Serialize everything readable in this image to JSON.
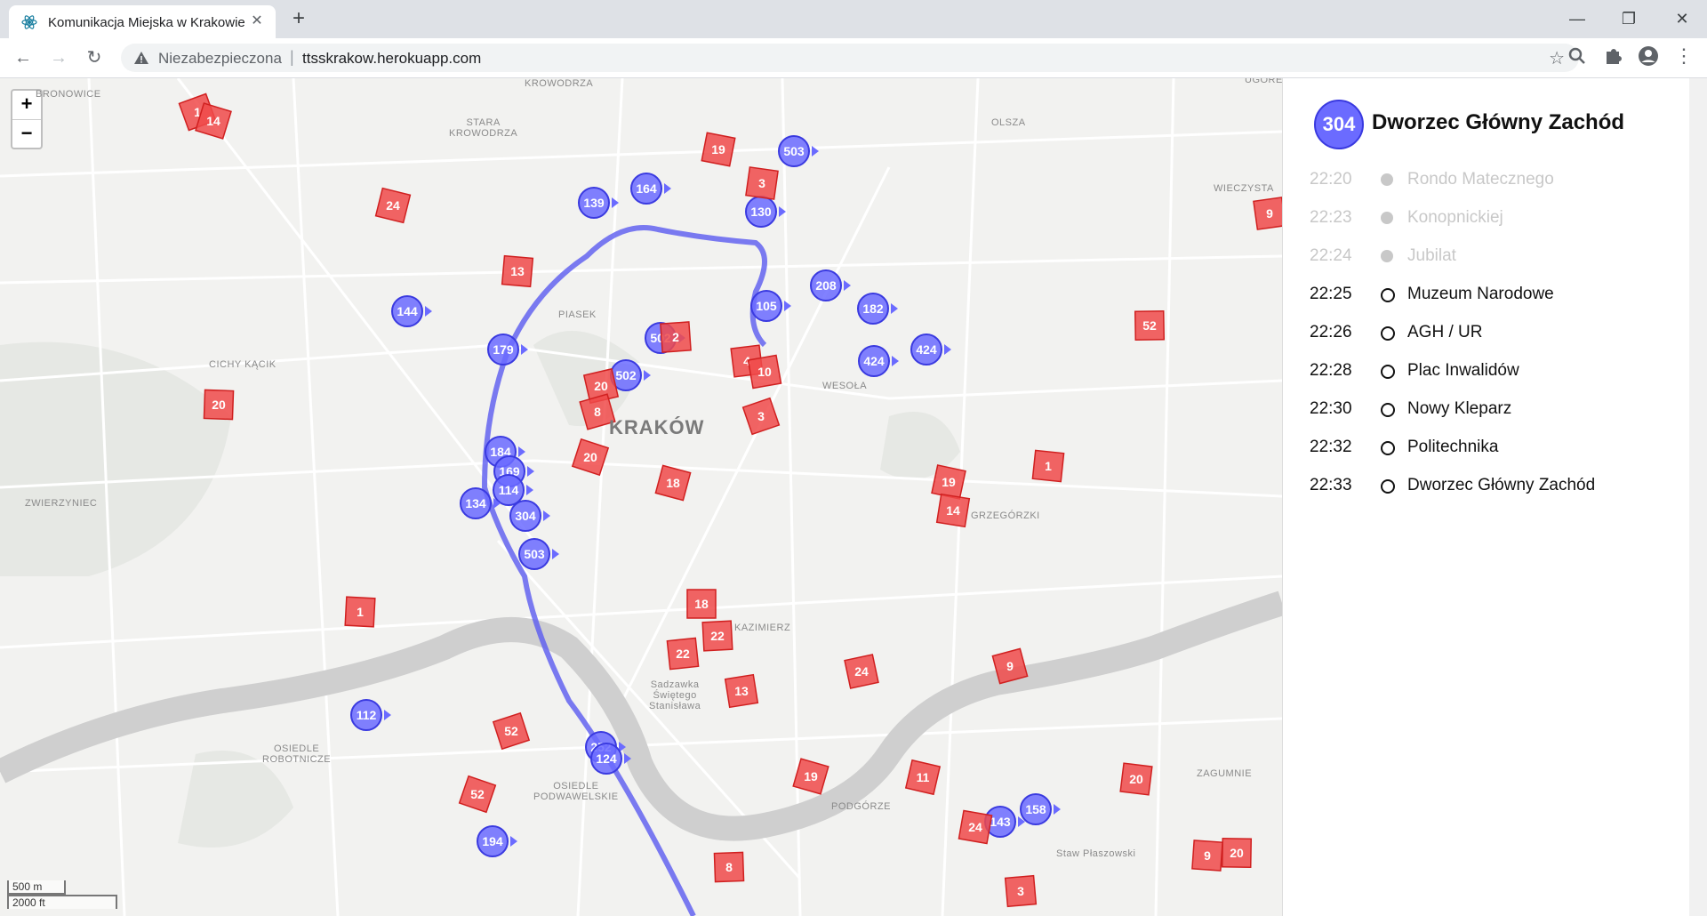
{
  "browser": {
    "tab_title": "Komunikacja Miejska w Krakowie",
    "tab_close": "✕",
    "new_tab": "+",
    "insecure_label": "Niezabezpieczona",
    "url": "ttsskrakow.herokuapp.com",
    "window_controls": {
      "minimize": "—",
      "restore": "❐",
      "close": "✕"
    },
    "nav": {
      "back": "←",
      "forward": "→",
      "reload": "↻"
    },
    "star": "☆",
    "icons": {
      "favicon": "react-logo-icon",
      "warning": "warning-triangle-icon",
      "extensions": "puzzle-icon",
      "profile": "account-circle-icon",
      "search_ext": "magnifier-icon"
    }
  },
  "map": {
    "zoom_in": "+",
    "zoom_out": "−",
    "scale_metric": "500 m",
    "scale_imperial": "2000 ft",
    "city_label": "KRAKÓW",
    "place_labels": [
      {
        "id": "krowodrza",
        "text": "KROWODRZA"
      },
      {
        "id": "stara-krowodrza",
        "text": "STARA\nKROWODRZA"
      },
      {
        "id": "olsza",
        "text": "OLSZA"
      },
      {
        "id": "piasek",
        "text": "PIASEK"
      },
      {
        "id": "cichy-kacik",
        "text": "CICHY KĄCIK"
      },
      {
        "id": "wesola",
        "text": "WESOŁA"
      },
      {
        "id": "zwierzyniec",
        "text": "ZWIERZYNIEC"
      },
      {
        "id": "grzegorzki",
        "text": "GRZEGÓRZKI"
      },
      {
        "id": "kazimierz",
        "text": "KAZIMIERZ"
      },
      {
        "id": "sadzawka",
        "text": "Sadzawka\nŚwiętego\nStanisława"
      },
      {
        "id": "osiedle-robotnicze",
        "text": "OSIEDLE\nROBOTNICZE"
      },
      {
        "id": "osiedle-podwawelskie",
        "text": "OSIEDLE\nPODWAWELSKIE"
      },
      {
        "id": "podgorze",
        "text": "PODGÓRZE"
      },
      {
        "id": "zagumnie",
        "text": "ZAGUMNIE"
      },
      {
        "id": "wieczysta",
        "text": "WIECZYSTA"
      },
      {
        "id": "bronowice",
        "text": "BRONOWICE"
      },
      {
        "id": "staw",
        "text": "Staw Płaszowski"
      },
      {
        "id": "ugorek",
        "text": "UGOREK"
      }
    ],
    "buses": [
      "164",
      "503",
      "139",
      "130",
      "105",
      "208",
      "182",
      "144",
      "179",
      "424",
      "424",
      "502",
      "502",
      "184",
      "169",
      "114",
      "134",
      "304",
      "503",
      "112",
      "252",
      "124",
      "194",
      "143",
      "158"
    ],
    "trams": [
      "1",
      "14",
      "24",
      "19",
      "3",
      "13",
      "20",
      "52",
      "2",
      "4",
      "10",
      "20",
      "8",
      "3",
      "20",
      "18",
      "19",
      "14",
      "1",
      "1",
      "18",
      "22",
      "22",
      "13",
      "24",
      "9",
      "52",
      "52",
      "19",
      "11",
      "24",
      "20",
      "9",
      "20",
      "8",
      "3",
      "9"
    ]
  },
  "panel": {
    "route_number": "304",
    "stop_name": "Dworzec Główny Zachód",
    "stops": [
      {
        "time": "22:20",
        "name": "Rondo Matecznego",
        "state": "past"
      },
      {
        "time": "22:23",
        "name": "Konopnickiej",
        "state": "past"
      },
      {
        "time": "22:24",
        "name": "Jubilat",
        "state": "past"
      },
      {
        "time": "22:25",
        "name": "Muzeum Narodowe",
        "state": "future"
      },
      {
        "time": "22:26",
        "name": "AGH / UR",
        "state": "future"
      },
      {
        "time": "22:28",
        "name": "Plac Inwalidów",
        "state": "future"
      },
      {
        "time": "22:30",
        "name": "Nowy Kleparz",
        "state": "future"
      },
      {
        "time": "22:32",
        "name": "Politechnika",
        "state": "future"
      },
      {
        "time": "22:33",
        "name": "Dworzec Główny Zachód",
        "state": "future"
      }
    ]
  },
  "colors": {
    "bus": "#6b6bff",
    "bus_border": "#3a3ae0",
    "tram": "#f04a4a",
    "route_line": "#5a5af0",
    "river": "#c8c8c8"
  }
}
